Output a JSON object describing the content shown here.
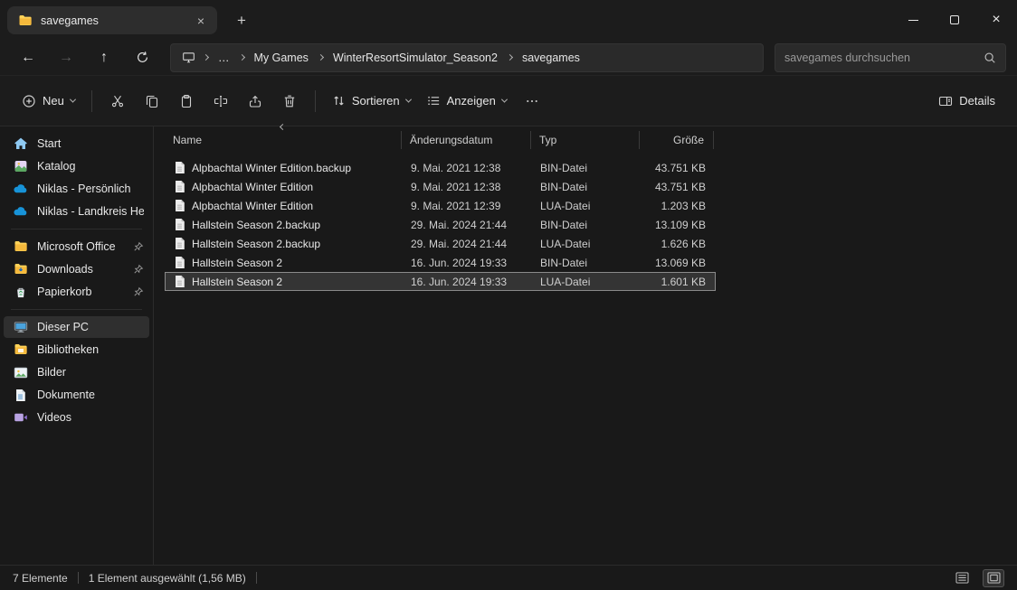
{
  "colors": {
    "window_bg": "#191919",
    "bar_bg": "#1c1c1c",
    "field_bg": "#2a2a2a",
    "selection_bg": "#343434",
    "selection_border": "#8a8a8a",
    "folder_yellow": "#f5b93c",
    "onedrive_blue": "#1793d8"
  },
  "titlebar": {
    "tab": {
      "title": "savegames"
    }
  },
  "navbar": {
    "breadcrumb": {
      "ellipsis": "…",
      "items": [
        "My Games",
        "WinterResortSimulator_Season2",
        "savegames"
      ]
    },
    "search": {
      "placeholder": "savegames durchsuchen"
    }
  },
  "toolbar": {
    "new": "Neu",
    "sort": "Sortieren",
    "view": "Anzeigen",
    "details": "Details"
  },
  "sidebar": {
    "groups": [
      {
        "items": [
          {
            "label": "Start",
            "icon": "home-icon"
          },
          {
            "label": "Katalog",
            "icon": "gallery-icon"
          },
          {
            "label": "Niklas - Persönlich",
            "icon": "onedrive-icon"
          },
          {
            "label": "Niklas - Landkreis Heid",
            "icon": "onedrive-icon"
          }
        ]
      },
      {
        "items": [
          {
            "label": "Microsoft Office",
            "icon": "folder-icon",
            "pinned": true
          },
          {
            "label": "Downloads",
            "icon": "downloads-folder-icon",
            "pinned": true
          },
          {
            "label": "Papierkorb",
            "icon": "recycle-bin-icon",
            "pinned": true
          }
        ]
      },
      {
        "items": [
          {
            "label": "Dieser PC",
            "icon": "pc-icon",
            "selected": true
          },
          {
            "label": "Bibliotheken",
            "icon": "library-icon"
          },
          {
            "label": "Bilder",
            "icon": "pictures-icon"
          },
          {
            "label": "Dokumente",
            "icon": "documents-icon"
          },
          {
            "label": "Videos",
            "icon": "videos-icon"
          }
        ]
      }
    ]
  },
  "filelist": {
    "columns": {
      "name": "Name",
      "date": "Änderungsdatum",
      "type": "Typ",
      "size": "Größe"
    },
    "sort": {
      "column": "Name",
      "direction": "ascending"
    },
    "rows": [
      {
        "name": "Alpbachtal Winter Edition.backup",
        "date": "9. Mai. 2021 12:38",
        "type": "BIN-Datei",
        "size": "43.751 KB"
      },
      {
        "name": "Alpbachtal Winter Edition",
        "date": "9. Mai. 2021 12:38",
        "type": "BIN-Datei",
        "size": "43.751 KB"
      },
      {
        "name": "Alpbachtal Winter Edition",
        "date": "9. Mai. 2021 12:39",
        "type": "LUA-Datei",
        "size": "1.203 KB"
      },
      {
        "name": "Hallstein Season 2.backup",
        "date": "29. Mai. 2024 21:44",
        "type": "BIN-Datei",
        "size": "13.109 KB"
      },
      {
        "name": "Hallstein Season 2.backup",
        "date": "29. Mai. 2024 21:44",
        "type": "LUA-Datei",
        "size": "1.626 KB"
      },
      {
        "name": "Hallstein Season 2",
        "date": "16. Jun. 2024 19:33",
        "type": "BIN-Datei",
        "size": "13.069 KB"
      },
      {
        "name": "Hallstein Season 2",
        "date": "16. Jun. 2024 19:33",
        "type": "LUA-Datei",
        "size": "1.601 KB",
        "selected": true
      }
    ]
  },
  "statusbar": {
    "count": "7 Elemente",
    "selection": "1 Element ausgewählt (1,56 MB)"
  }
}
